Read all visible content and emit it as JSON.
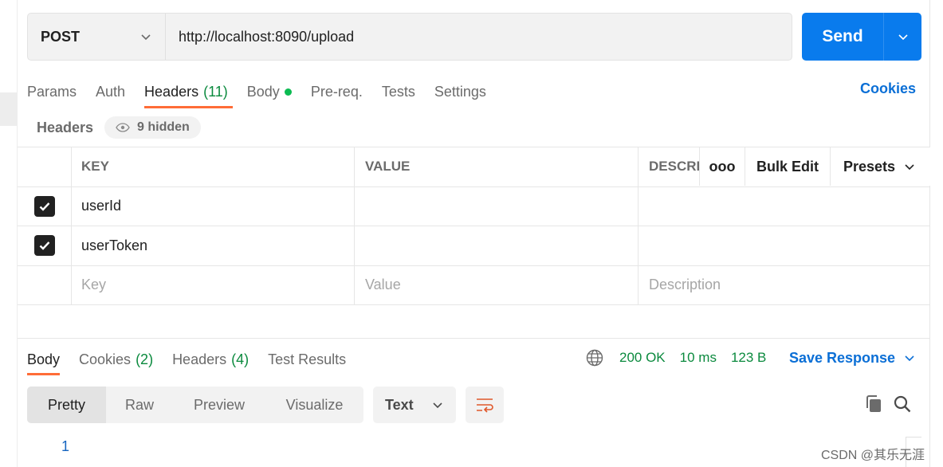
{
  "request": {
    "method": "POST",
    "url": "http://localhost:8090/upload",
    "send_label": "Send"
  },
  "request_tabs": [
    {
      "label": "Params"
    },
    {
      "label": "Auth"
    },
    {
      "label": "Headers",
      "count": "(11)"
    },
    {
      "label": "Body"
    },
    {
      "label": "Pre-req."
    },
    {
      "label": "Tests"
    },
    {
      "label": "Settings"
    }
  ],
  "cookies_link": "Cookies",
  "headers_section": {
    "label": "Headers",
    "hidden_label": "9 hidden"
  },
  "table": {
    "columns": [
      "KEY",
      "VALUE",
      "DESCRI"
    ],
    "tools": {
      "more": "ooo",
      "bulk_edit": "Bulk Edit",
      "presets": "Presets"
    },
    "rows": [
      {
        "key": "userId",
        "value": "",
        "description": "",
        "checked": true
      },
      {
        "key": "userToken",
        "value": "",
        "description": "",
        "checked": true
      }
    ],
    "placeholders": {
      "key": "Key",
      "value": "Value",
      "description": "Description"
    }
  },
  "response": {
    "tabs": [
      {
        "label": "Body"
      },
      {
        "label": "Cookies",
        "count": "(2)"
      },
      {
        "label": "Headers",
        "count": "(4)"
      },
      {
        "label": "Test Results"
      }
    ],
    "status": "200 OK",
    "time": "10 ms",
    "size": "123 B",
    "save_label": "Save Response",
    "view_tabs": [
      "Pretty",
      "Raw",
      "Preview",
      "Visualize"
    ],
    "format": "Text",
    "line_number": "1"
  },
  "watermark": "CSDN @其乐无涯",
  "colors": {
    "accent": "#ff6c37",
    "send_button": "#097bed",
    "link": "#0b6fd6",
    "status_green": "#0b8a3e"
  }
}
